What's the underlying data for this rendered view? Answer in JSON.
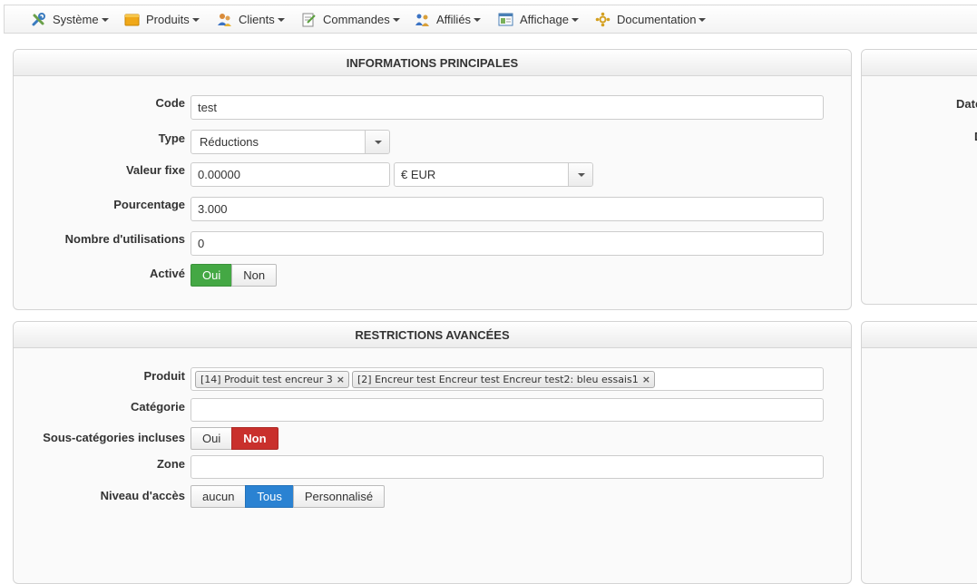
{
  "menu": {
    "items": [
      {
        "label": "Système",
        "icon": "tools-icon"
      },
      {
        "label": "Produits",
        "icon": "box-icon"
      },
      {
        "label": "Clients",
        "icon": "users-icon"
      },
      {
        "label": "Commandes",
        "icon": "order-icon"
      },
      {
        "label": "Affiliés",
        "icon": "affiliate-icon"
      },
      {
        "label": "Affichage",
        "icon": "display-icon"
      },
      {
        "label": "Documentation",
        "icon": "doc-icon"
      }
    ]
  },
  "main_info": {
    "title": "INFORMATIONS PRINCIPALES",
    "code_label": "Code",
    "code_value": "test",
    "type_label": "Type",
    "type_value": "Réductions",
    "fixed_label": "Valeur fixe",
    "fixed_value": "0.00000",
    "currency_value": "€ EUR",
    "percent_label": "Pourcentage",
    "percent_value": "3.000",
    "uses_label": "Nombre d'utilisations",
    "uses_value": "0",
    "active_label": "Activé",
    "active_yes": "Oui",
    "active_no": "Non"
  },
  "side_panel": {
    "label1": "Date",
    "label2": "D"
  },
  "restrictions": {
    "title": "RESTRICTIONS AVANCÉES",
    "product_label": "Produit",
    "products": [
      "[14] Produit test encreur 3",
      "[2] Encreur test Encreur test Encreur test2: bleu essais1"
    ],
    "category_label": "Catégorie",
    "subcat_label": "Sous-catégories incluses",
    "subcat_yes": "Oui",
    "subcat_no": "Non",
    "zone_label": "Zone",
    "access_label": "Niveau d'accès",
    "access_none": "aucun",
    "access_all": "Tous",
    "access_custom": "Personnalisé"
  },
  "colors": {
    "active_green": "#44a844",
    "inactive_red": "#c9302c",
    "selected_blue": "#2a82d2"
  }
}
